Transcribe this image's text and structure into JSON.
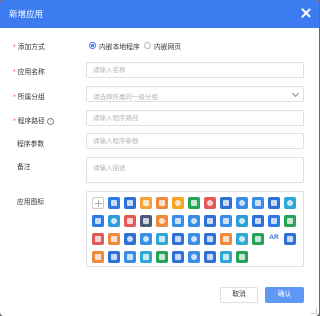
{
  "dialog": {
    "title": "新增应用"
  },
  "form": {
    "add_method": {
      "label": "添加方式",
      "options": [
        "内嵌本地程序",
        "内嵌网页"
      ],
      "selected": "内嵌本地程序"
    },
    "app_name": {
      "label": "应用名称",
      "placeholder": "请输入名称",
      "value": ""
    },
    "group": {
      "label": "所属分组",
      "placeholder": "请选择所属的一级分组"
    },
    "program_path": {
      "label": "程序路径",
      "placeholder": "请输入程序路径",
      "value": ""
    },
    "program_args": {
      "label": "程序参数",
      "placeholder": "请输入程序参数",
      "value": ""
    },
    "remarks": {
      "label": "备注",
      "placeholder": "请输入描述",
      "value": ""
    },
    "app_icon": {
      "label": "应用图标",
      "icons": [
        {
          "name": "add-icon",
          "color": "#ffffff",
          "shape": "add"
        },
        {
          "name": "user-window-icon",
          "color": "#2e7be8",
          "shape": "sq"
        },
        {
          "name": "video-camera-icon",
          "color": "#2f6fd6",
          "shape": "sq"
        },
        {
          "name": "folder-icon",
          "color": "#f2a33a",
          "shape": "sq"
        },
        {
          "name": "mail-icon",
          "color": "#f08a3c",
          "shape": "sq"
        },
        {
          "name": "image-icon",
          "color": "#f5a623",
          "shape": "c"
        },
        {
          "name": "tree-icon",
          "color": "#27a35a",
          "shape": "sq"
        },
        {
          "name": "person-icon",
          "color": "#e25a5a",
          "shape": "c"
        },
        {
          "name": "badge-icon",
          "color": "#2f6fd6",
          "shape": "sq"
        },
        {
          "name": "gear-icon",
          "color": "#3a8ee6",
          "shape": "c"
        },
        {
          "name": "document-icon",
          "color": "#3a8ee6",
          "shape": "sq"
        },
        {
          "name": "book-icon",
          "color": "#2f6fd6",
          "shape": "sq"
        },
        {
          "name": "globe-icon",
          "color": "#2fa8d6",
          "shape": "c"
        },
        {
          "name": "chat-icon",
          "color": "#2e7be8",
          "shape": "sq"
        },
        {
          "name": "network-icon",
          "color": "#2f9ed6",
          "shape": "c"
        },
        {
          "name": "calendar-icon",
          "color": "#e25a5a",
          "shape": "sq"
        },
        {
          "name": "printer-icon",
          "color": "#4a5a78",
          "shape": "sq"
        },
        {
          "name": "headset-icon",
          "color": "#f08a3c",
          "shape": "c"
        },
        {
          "name": "wrench-icon",
          "color": "#3a8ee6",
          "shape": "sq"
        },
        {
          "name": "people-icon",
          "color": "#3a8ee6",
          "shape": "c"
        },
        {
          "name": "toolbox-icon",
          "color": "#2f6fd6",
          "shape": "sq"
        },
        {
          "name": "mobile-icon",
          "color": "#3a8ee6",
          "shape": "sq"
        },
        {
          "name": "disk-icon",
          "color": "#2f9ed6",
          "shape": "c"
        },
        {
          "name": "clipboard-icon",
          "color": "#2f6fd6",
          "shape": "sq"
        },
        {
          "name": "monitor-icon",
          "color": "#2e7be8",
          "shape": "sq"
        },
        {
          "name": "folder-green-icon",
          "color": "#27a35a",
          "shape": "sq"
        },
        {
          "name": "user-card-icon",
          "color": "#e25a5a",
          "shape": "sq"
        },
        {
          "name": "file-icon",
          "color": "#f08a3c",
          "shape": "sq"
        },
        {
          "name": "search-icon",
          "color": "#2f6fd6",
          "shape": "c"
        },
        {
          "name": "cloud-icon",
          "color": "#3a8ee6",
          "shape": "c"
        },
        {
          "name": "team-icon",
          "color": "#2fa8d6",
          "shape": "sq"
        },
        {
          "name": "server-icon",
          "color": "#2f6fd6",
          "shape": "sq"
        },
        {
          "name": "database-icon",
          "color": "#3a8ee6",
          "shape": "c"
        },
        {
          "name": "chart-icon",
          "color": "#2f6fd6",
          "shape": "sq"
        },
        {
          "name": "play-icon",
          "color": "#f08a3c",
          "shape": "sq"
        },
        {
          "name": "music-icon",
          "color": "#2fa8d6",
          "shape": "c"
        },
        {
          "name": "photo-icon",
          "color": "#27a35a",
          "shape": "sq"
        },
        {
          "name": "ar-icon",
          "color": "#ffffff",
          "shape": "txt",
          "text": "AR"
        },
        {
          "name": "grid-icon",
          "color": "#2f6fd6",
          "shape": "sq"
        },
        {
          "name": "apps-icon",
          "color": "#f08a3c",
          "shape": "sq"
        },
        {
          "name": "tablet-icon",
          "color": "#2f6fd6",
          "shape": "sq"
        },
        {
          "name": "projector-icon",
          "color": "#3a8ee6",
          "shape": "sq"
        },
        {
          "name": "screen-icon",
          "color": "#2fa8d6",
          "shape": "sq"
        },
        {
          "name": "terminal-icon",
          "color": "#27a35a",
          "shape": "sq"
        },
        {
          "name": "cube-icon",
          "color": "#2f6fd6",
          "shape": "sq"
        },
        {
          "name": "compass-icon",
          "color": "#3a8ee6",
          "shape": "c"
        },
        {
          "name": "shield-icon",
          "color": "#2f6fd6",
          "shape": "sq"
        },
        {
          "name": "lock-icon",
          "color": "#2fa8d6",
          "shape": "sq"
        },
        {
          "name": "phone-icon",
          "color": "#27a35a",
          "shape": "sq"
        }
      ]
    }
  },
  "buttons": {
    "cancel": "取消",
    "confirm": "确认"
  },
  "colors": {
    "primary": "#3d7cf0",
    "confirm": "#5f97f6",
    "required": "#e53935"
  }
}
